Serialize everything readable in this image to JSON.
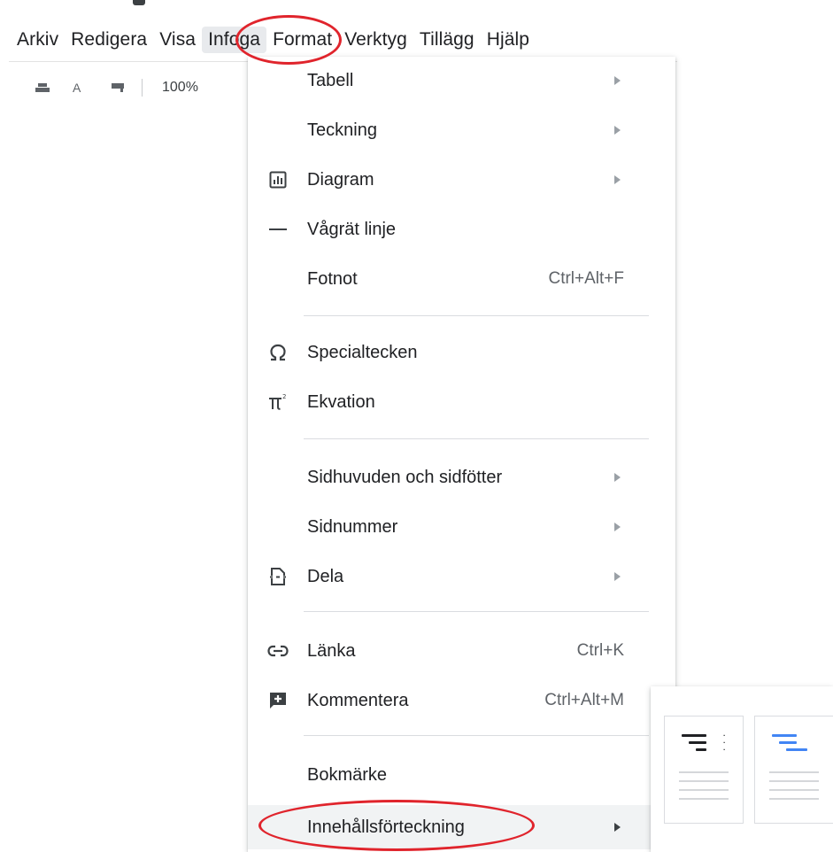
{
  "menubar": {
    "items": [
      {
        "label": "Arkiv"
      },
      {
        "label": "Redigera"
      },
      {
        "label": "Visa"
      },
      {
        "label": "Infoga"
      },
      {
        "label": "Format"
      },
      {
        "label": "Verktyg"
      },
      {
        "label": "Tillägg"
      },
      {
        "label": "Hjälp"
      }
    ],
    "active_index": 3
  },
  "toolbar": {
    "spellcheck_glyph": "A",
    "zoom": "100%",
    "icons": [
      "print-icon",
      "spellcheck-icon",
      "paint-format-icon"
    ]
  },
  "insert_menu": {
    "items": [
      {
        "label": "Tabell",
        "icon": "",
        "shortcut": "",
        "submenu": true
      },
      {
        "label": "Teckning",
        "icon": "",
        "shortcut": "",
        "submenu": true
      },
      {
        "label": "Diagram",
        "icon": "chart-icon",
        "shortcut": "",
        "submenu": true
      },
      {
        "label": "Vågrät linje",
        "icon": "horizontal-line-icon",
        "shortcut": "",
        "submenu": false
      },
      {
        "label": "Fotnot",
        "icon": "",
        "shortcut": "Ctrl+Alt+F",
        "submenu": false
      },
      {
        "label": "Specialtecken",
        "icon": "omega-icon",
        "shortcut": "",
        "submenu": false
      },
      {
        "label": "Ekvation",
        "icon": "pi-icon",
        "shortcut": "",
        "submenu": false
      },
      {
        "label": "Sidhuvuden och sidfötter",
        "icon": "",
        "shortcut": "",
        "submenu": true
      },
      {
        "label": "Sidnummer",
        "icon": "",
        "shortcut": "",
        "submenu": true
      },
      {
        "label": "Dela",
        "icon": "page-break-icon",
        "shortcut": "",
        "submenu": true
      },
      {
        "label": "Länka",
        "icon": "link-icon",
        "shortcut": "Ctrl+K",
        "submenu": false
      },
      {
        "label": "Kommentera",
        "icon": "add-comment-icon",
        "shortcut": "Ctrl+Alt+M",
        "submenu": false
      },
      {
        "label": "Bokmärke",
        "icon": "",
        "shortcut": "",
        "submenu": false
      },
      {
        "label": "Innehållsförteckning",
        "icon": "",
        "shortcut": "",
        "submenu": true
      }
    ],
    "highlighted_index": 13
  },
  "toc_submenu": {
    "options": [
      {
        "name": "toc-with-page-numbers",
        "accent": "#202124"
      },
      {
        "name": "toc-with-blue-links",
        "accent": "#4285f4"
      }
    ]
  },
  "annotations": {
    "color": "#e0242c",
    "circled": [
      "Infoga",
      "Innehållsförteckning"
    ]
  }
}
